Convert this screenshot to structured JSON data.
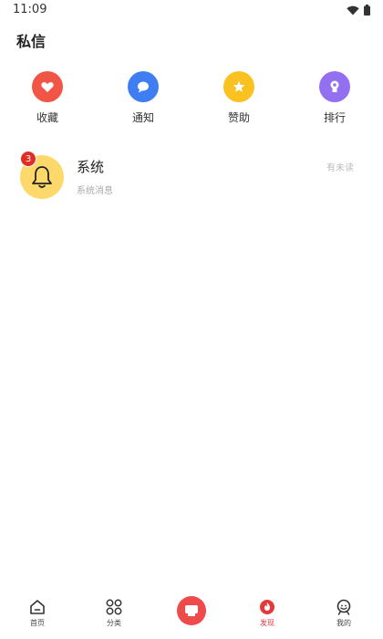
{
  "status_bar": {
    "time": "11:09"
  },
  "header": {
    "title": "私信"
  },
  "quick_actions": [
    {
      "label": "收藏",
      "icon": "heart-icon",
      "color": "#f05545"
    },
    {
      "label": "通知",
      "icon": "chat-bubble-icon",
      "color": "#3f7df2"
    },
    {
      "label": "赞助",
      "icon": "star-icon",
      "color": "#f9c221"
    },
    {
      "label": "排行",
      "icon": "ranking-icon",
      "color": "#9270f0"
    }
  ],
  "messages": [
    {
      "title": "系统",
      "subtitle": "系统消息",
      "status": "有未读",
      "badge": "3",
      "icon": "bell-icon",
      "avatar_color": "#fcd96a"
    }
  ],
  "tab_bar": {
    "accent": "#e33b3b",
    "tabs": [
      {
        "label": "首页",
        "icon": "home-icon"
      },
      {
        "label": "分类",
        "icon": "category-grid-icon"
      },
      {
        "label": "",
        "icon": "center-action-icon"
      },
      {
        "label": "发现",
        "icon": "flame-icon",
        "active": true
      },
      {
        "label": "我的",
        "icon": "profile-icon"
      }
    ]
  }
}
